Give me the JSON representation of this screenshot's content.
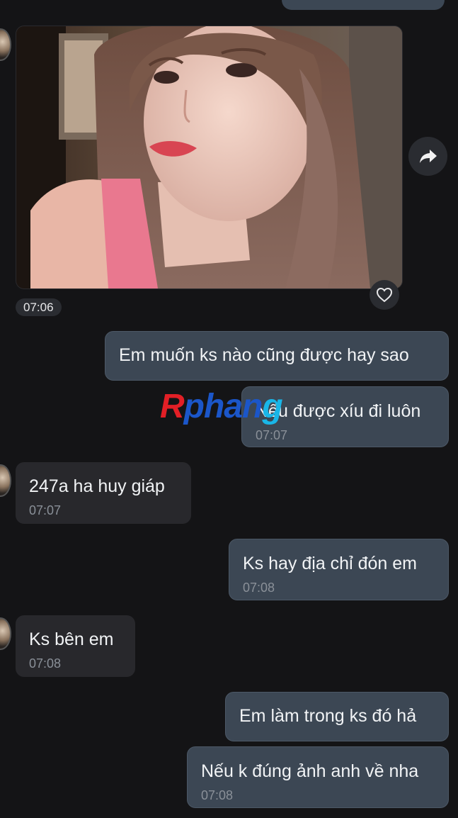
{
  "watermark": {
    "r": "R",
    "mid": "phan",
    "g": "g"
  },
  "photo_message": {
    "time": "07:06"
  },
  "icons": {
    "forward": "forward-arrow-icon",
    "heart": "heart-outline-icon"
  },
  "messages": [
    {
      "side": "out",
      "text": "Em muốn ks nào cũng được hay sao",
      "time": ""
    },
    {
      "side": "out",
      "text": "Nếu được xíu đi luôn",
      "time": "07:07"
    },
    {
      "side": "in",
      "text": "247a ha huy giáp",
      "time": "07:07"
    },
    {
      "side": "out",
      "text": "Ks hay địa chỉ đón em",
      "time": "07:08"
    },
    {
      "side": "in",
      "text": "Ks bên em",
      "time": "07:08"
    },
    {
      "side": "out",
      "text": "Em làm trong ks đó hả",
      "time": ""
    },
    {
      "side": "out",
      "text": "Nếu k đúng ảnh anh về nha",
      "time": "07:08"
    }
  ],
  "colors": {
    "background": "#141416",
    "outgoing_bubble": "#3c4754",
    "incoming_bubble": "#28282c"
  }
}
